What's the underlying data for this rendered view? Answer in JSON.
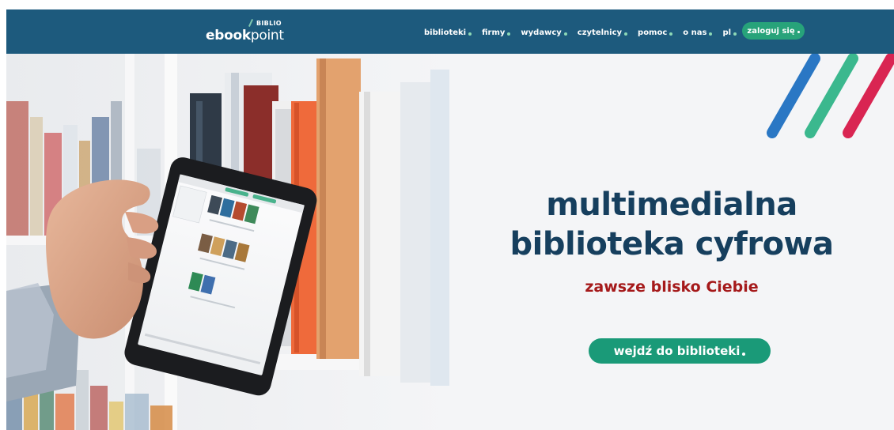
{
  "header": {
    "logo": {
      "tag": "BIBLIO",
      "main_bold": "ebook",
      "main_light": "point"
    },
    "nav": [
      {
        "label": "biblioteki"
      },
      {
        "label": "firmy"
      },
      {
        "label": "wydawcy"
      },
      {
        "label": "czytelnicy"
      },
      {
        "label": "pomoc"
      },
      {
        "label": "o nas"
      },
      {
        "label": "pl"
      }
    ],
    "login_label": "zaloguj się"
  },
  "hero": {
    "headline_line1": "multimedialna",
    "headline_line2": "biblioteka cyfrowa",
    "subheadline": "zawsze blisko Ciebie",
    "cta_label": "wejdź do biblioteki",
    "image_description_icon": "hand-holding-ereader-bookshelf-image"
  },
  "colors": {
    "header_bg": "#1d5a7d",
    "headline": "#163f5e",
    "subheadline": "#a5191a",
    "accent_green": "#1a9a78",
    "stripe_blue": "#2a77c4",
    "stripe_green": "#3bb88e",
    "stripe_red": "#d92552"
  }
}
